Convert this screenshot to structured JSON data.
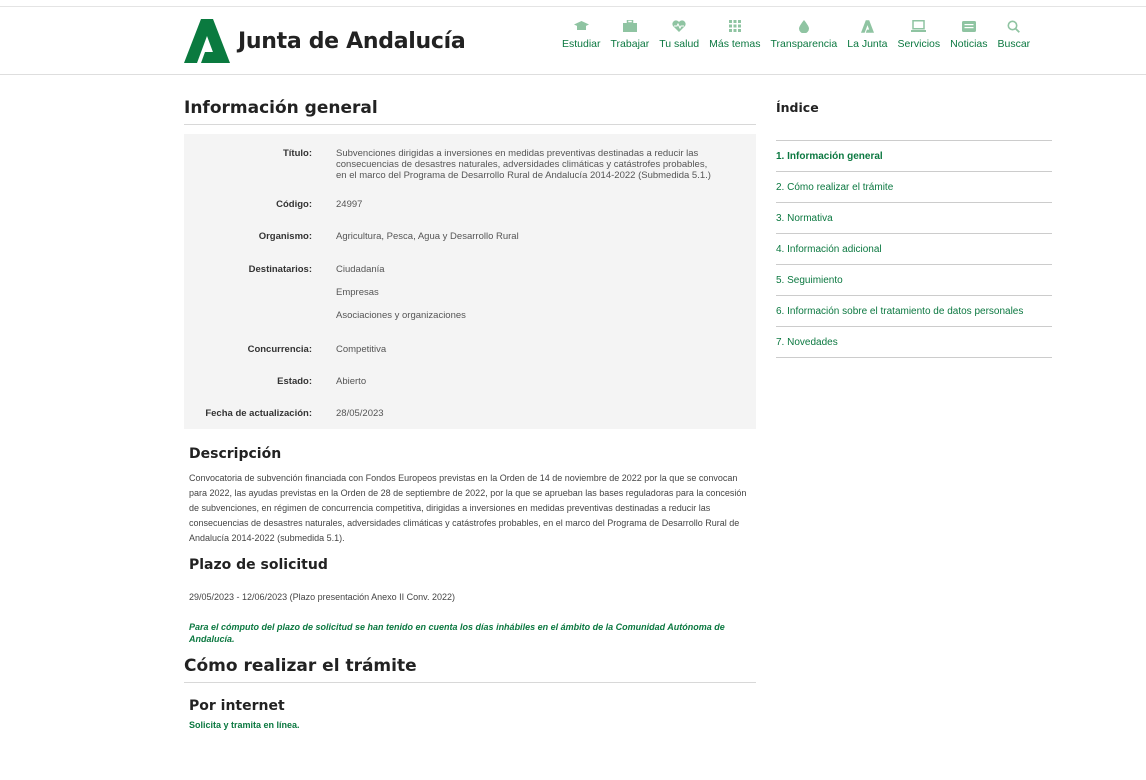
{
  "header": {
    "logo_text": "Junta de Andalucía",
    "nav": [
      {
        "label": "Estudiar",
        "icon": "graduation-cap-icon"
      },
      {
        "label": "Trabajar",
        "icon": "briefcase-icon"
      },
      {
        "label": "Tu salud",
        "icon": "heart-pulse-icon"
      },
      {
        "label": "Más temas",
        "icon": "grid-icon"
      },
      {
        "label": "Transparencia",
        "icon": "drop-icon"
      },
      {
        "label": "La Junta",
        "icon": "junta-logo-icon"
      },
      {
        "label": "Servicios",
        "icon": "laptop-icon"
      },
      {
        "label": "Noticias",
        "icon": "newspaper-icon"
      },
      {
        "label": "Buscar",
        "icon": "search-icon"
      }
    ]
  },
  "main": {
    "title": "Información general",
    "info": {
      "titulo_label": "Título:",
      "titulo_value": "Subvenciones dirigidas a inversiones en medidas preventivas destinadas a reducir las consecuencias de desastres naturales, adversidades climáticas y catástrofes probables, en el marco del Programa de Desarrollo Rural de Andalucía 2014-2022 (Submedida 5.1.)",
      "codigo_label": "Código:",
      "codigo_value": "24997",
      "organismo_label": "Organismo:",
      "organismo_value": "Agricultura, Pesca, Agua y Desarrollo Rural",
      "destinatarios_label": "Destinatarios:",
      "destinatarios_values": [
        "Ciudadanía",
        "Empresas",
        "Asociaciones y organizaciones"
      ],
      "concurrencia_label": "Concurrencia:",
      "concurrencia_value": "Competitiva",
      "estado_label": "Estado:",
      "estado_value": "Abierto",
      "fecha_label": "Fecha de actualización:",
      "fecha_value": "28/05/2023"
    },
    "descripcion_title": "Descripción",
    "descripcion_text": "Convocatoria de subvención financiada con Fondos Europeos previstas en la Orden de 14 de noviembre de 2022 por la que se convocan para 2022, las ayudas previstas en la Orden de 28 de septiembre de 2022, por la que se aprueban las bases reguladoras para la concesión de subvenciones, en régimen de concurrencia competitiva, dirigidas a inversiones en medidas preventivas destinadas a reducir las consecuencias de desastres naturales, adversidades climáticas y catástrofes probables, en el marco del Programa de Desarrollo Rural de Andalucía 2014-2022 (submedida 5.1).",
    "plazo_title": "Plazo de solicitud",
    "plazo_text": "29/05/2023 - 12/06/2023 (Plazo presentación Anexo II Conv. 2022)",
    "plazo_note": "Para el cómputo del plazo de solicitud se han tenido en cuenta los días inhábiles en el ámbito de la Comunidad Autónoma de Andalucía.",
    "tramite_title": "Cómo realizar el trámite",
    "internet_title": "Por internet",
    "internet_link": "Solicita y tramita en línea."
  },
  "sidebar": {
    "title": "Índice",
    "items": [
      "1. Información general",
      "2. Cómo realizar el trámite",
      "3. Normativa",
      "4. Información adicional",
      "5. Seguimiento",
      "6. Información sobre el tratamiento de datos personales",
      "7. Novedades"
    ]
  },
  "colors": {
    "brand_green": "#0b7840",
    "logo_green": "#0a7a3f",
    "nav_icon_green": "#8fc4a2",
    "info_box_bg": "#f4f4f4"
  }
}
